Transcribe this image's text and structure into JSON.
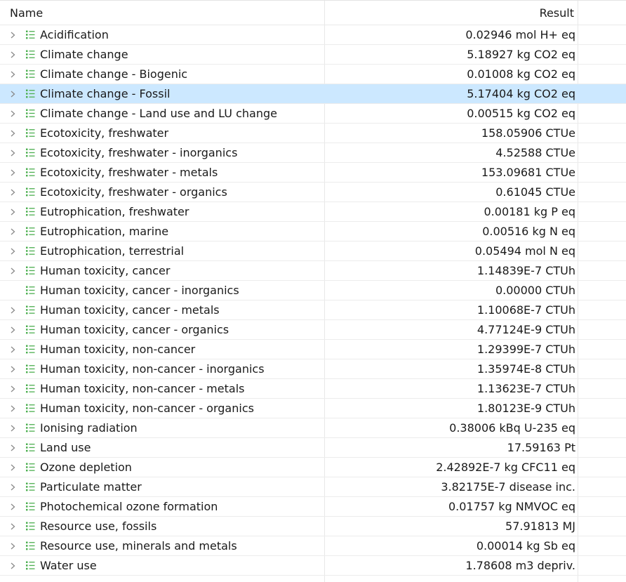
{
  "columns": {
    "name": "Name",
    "result": "Result"
  },
  "icons": {
    "expander": "chevron-right-icon",
    "category": "impact-category-icon"
  },
  "colors": {
    "selection": "#cce8ff",
    "category_icon": "#4caf50"
  },
  "rows": [
    {
      "name": "Acidification",
      "result": "0.02946 mol H+ eq",
      "expandable": true
    },
    {
      "name": "Climate change",
      "result": "5.18927 kg CO2 eq",
      "expandable": true
    },
    {
      "name": "Climate change - Biogenic",
      "result": "0.01008 kg CO2 eq",
      "expandable": true
    },
    {
      "name": "Climate change - Fossil",
      "result": "5.17404 kg CO2 eq",
      "expandable": true,
      "selected": true
    },
    {
      "name": "Climate change - Land use and LU change",
      "result": "0.00515 kg CO2 eq",
      "expandable": true
    },
    {
      "name": "Ecotoxicity, freshwater",
      "result": "158.05906 CTUe",
      "expandable": true
    },
    {
      "name": "Ecotoxicity, freshwater - inorganics",
      "result": "4.52588 CTUe",
      "expandable": true
    },
    {
      "name": "Ecotoxicity, freshwater - metals",
      "result": "153.09681 CTUe",
      "expandable": true
    },
    {
      "name": "Ecotoxicity, freshwater - organics",
      "result": "0.61045 CTUe",
      "expandable": true
    },
    {
      "name": "Eutrophication, freshwater",
      "result": "0.00181 kg P eq",
      "expandable": true
    },
    {
      "name": "Eutrophication, marine",
      "result": "0.00516 kg N eq",
      "expandable": true
    },
    {
      "name": "Eutrophication, terrestrial",
      "result": "0.05494 mol N eq",
      "expandable": true
    },
    {
      "name": "Human toxicity, cancer",
      "result": "1.14839E-7 CTUh",
      "expandable": true
    },
    {
      "name": "Human toxicity, cancer - inorganics",
      "result": "0.00000 CTUh",
      "expandable": false
    },
    {
      "name": "Human toxicity, cancer - metals",
      "result": "1.10068E-7 CTUh",
      "expandable": true
    },
    {
      "name": "Human toxicity, cancer - organics",
      "result": "4.77124E-9 CTUh",
      "expandable": true
    },
    {
      "name": "Human toxicity, non-cancer",
      "result": "1.29399E-7 CTUh",
      "expandable": true
    },
    {
      "name": "Human toxicity, non-cancer - inorganics",
      "result": "1.35974E-8 CTUh",
      "expandable": true
    },
    {
      "name": "Human toxicity, non-cancer - metals",
      "result": "1.13623E-7 CTUh",
      "expandable": true
    },
    {
      "name": "Human toxicity, non-cancer - organics",
      "result": "1.80123E-9 CTUh",
      "expandable": true
    },
    {
      "name": "Ionising radiation",
      "result": "0.38006 kBq U-235 eq",
      "expandable": true
    },
    {
      "name": "Land use",
      "result": "17.59163 Pt",
      "expandable": true
    },
    {
      "name": "Ozone depletion",
      "result": "2.42892E-7 kg CFC11 eq",
      "expandable": true
    },
    {
      "name": "Particulate matter",
      "result": "3.82175E-7 disease inc.",
      "expandable": true
    },
    {
      "name": "Photochemical ozone formation",
      "result": "0.01757 kg NMVOC eq",
      "expandable": true
    },
    {
      "name": "Resource use, fossils",
      "result": "57.91813 MJ",
      "expandable": true
    },
    {
      "name": "Resource use, minerals and metals",
      "result": "0.00014 kg Sb eq",
      "expandable": true
    },
    {
      "name": "Water use",
      "result": "1.78608 m3 depriv.",
      "expandable": true
    }
  ]
}
